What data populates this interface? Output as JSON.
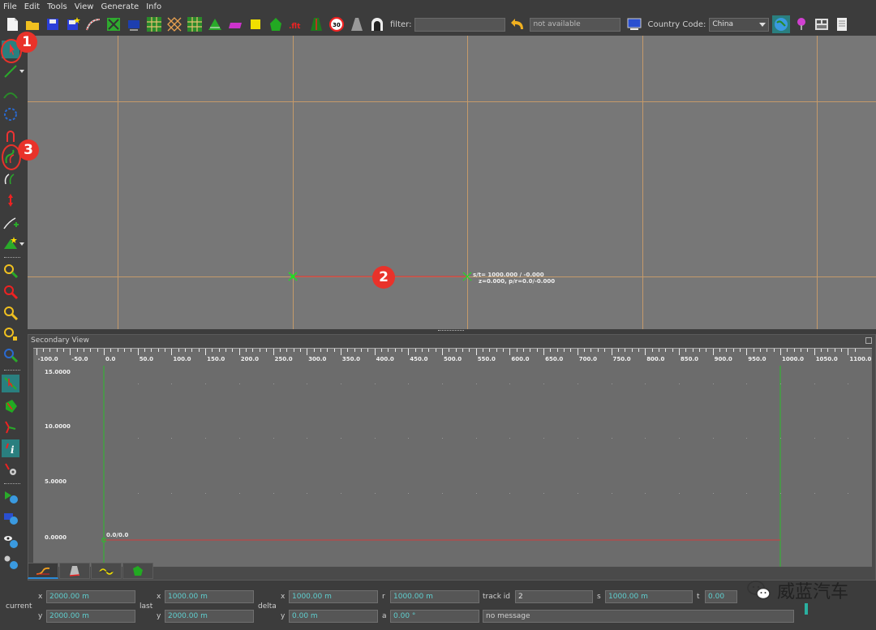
{
  "menu": [
    "File",
    "Edit",
    "Tools",
    "View",
    "Generate",
    "Info"
  ],
  "toolbar": {
    "filter_label": "filter:",
    "filter_value": "",
    "status_placeholder": "not available",
    "country_label": "Country Code:",
    "country_value": "China"
  },
  "main_view": {
    "road_info_line1": "s/t= 1000.000 / -0.000",
    "road_info_line2": "z=0.000, p/r=0.0/-0.000"
  },
  "secondary": {
    "title": "Secondary View",
    "x_ticks": [
      "-100.0",
      "-50.0",
      "0.0",
      "50.0",
      "100.0",
      "150.0",
      "200.0",
      "250.0",
      "300.0",
      "350.0",
      "400.0",
      "450.0",
      "500.0",
      "550.0",
      "600.0",
      "650.0",
      "700.0",
      "750.0",
      "800.0",
      "850.0",
      "900.0",
      "950.0",
      "1000.0",
      "1050.0",
      "1100.0"
    ],
    "y_ticks": [
      "15.0000",
      "10.0000",
      "5.0000",
      "0.0000"
    ],
    "point_label": "0.0/0.0"
  },
  "status": {
    "current_label": "current",
    "last_label": "last",
    "delta_label": "delta",
    "x_label": "x",
    "y_label": "y",
    "current_x": "2000.00 m",
    "current_y": "2000.00 m",
    "last_x": "1000.00 m",
    "last_y": "2000.00 m",
    "delta_x": "1000.00 m",
    "delta_y": "0.00 m",
    "r_label": "r",
    "r_value": "1000.00 m",
    "a_label": "a",
    "a_value": "0.00 °",
    "track_id_label": "track id",
    "track_id_value": "2",
    "s_label": "s",
    "s_value": "1000.00 m",
    "t_label": "t",
    "t_value": "0.00",
    "message": "no message"
  },
  "annotations": {
    "badge1": "1",
    "badge2": "2",
    "badge3": "3"
  },
  "watermark": {
    "text": "威蓝汽车"
  },
  "colors": {
    "accent_red": "#e9322a",
    "grid": "#c59a6a",
    "road": "#d23b3b",
    "node": "#22dd22"
  }
}
